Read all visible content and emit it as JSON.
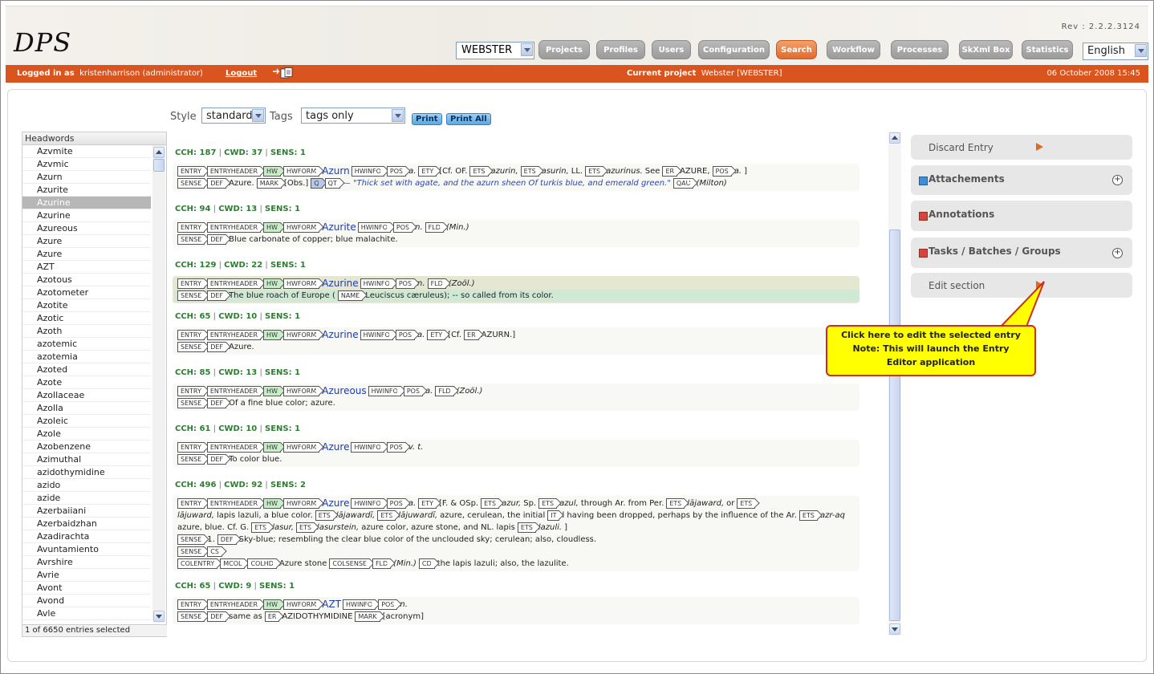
{
  "header": {
    "logo": "DPS",
    "revision": "Rev : 2.2.2.3124",
    "project_select": "WEBSTER",
    "nav": [
      "Projects",
      "Profiles",
      "Users",
      "Configuration",
      "Search",
      "Workflow",
      "Processes",
      "SkXml Box",
      "Statistics"
    ],
    "active_nav": "Search",
    "language": "English",
    "accent_color": "#d9541e"
  },
  "statusbar": {
    "logged_label": "Logged in as",
    "user": "kristenharrison (administrator)",
    "logout": "Logout",
    "current_project_label": "Current project",
    "current_project": "Webster [WEBSTER]",
    "date": "06 October 2008 15:45"
  },
  "toolbar": {
    "style_label": "Style",
    "style_value": "standard",
    "tags_label": "Tags",
    "tags_value": "tags only",
    "print": "Print",
    "print_all": "Print All"
  },
  "headwords": {
    "title": "Headwords",
    "items": [
      "Azvmite",
      "Azvmic",
      "Azurn",
      "Azurite",
      "Azurine",
      "Azurine",
      "Azureous",
      "Azure",
      "Azure",
      "AZT",
      "Azotous",
      "Azotometer",
      "Azotite",
      "Azotic",
      "Azoth",
      "azotemic",
      "azotemia",
      "Azoted",
      "Azote",
      "Azollaceae",
      "Azolla",
      "Azoleic",
      "Azole",
      "Azobenzene",
      "Azimuthal",
      "azidothymidine",
      "azido",
      "azide",
      "Azerbaiiani",
      "Azerbaidzhan",
      "Azadirachta",
      "Avuntamiento",
      "Avrshire",
      "Avrie",
      "Avont",
      "Avond",
      "Avle"
    ],
    "selected_index": 4,
    "status": "1 of 6650 entries selected"
  },
  "entries": [
    {
      "stats": {
        "cch": "CCH: 187",
        "cwd": "CWD: 37",
        "sens": "SENS: 1"
      },
      "rows": [
        [
          [
            "tag",
            "ENTRY"
          ],
          [
            "tag",
            "ENTRYHEADER"
          ],
          [
            "taghw",
            "HW"
          ],
          [
            "tag",
            "HWFORM"
          ],
          [
            "word",
            "Azurn"
          ],
          [
            "tag",
            "HWINFO"
          ],
          [
            "tag",
            "POS"
          ],
          [
            "it",
            "a."
          ],
          [
            "tag",
            "ETY"
          ],
          [
            "txt",
            "[Cf. OF."
          ],
          [
            "tag",
            "ETS"
          ],
          [
            "it",
            "azurin,"
          ],
          [
            "tag",
            "ETS"
          ],
          [
            "it",
            "asurin,"
          ],
          [
            "txt",
            "LL."
          ],
          [
            "tag",
            "ETS"
          ],
          [
            "it",
            "azurinus."
          ],
          [
            "txt",
            "See"
          ],
          [
            "tag",
            "ER"
          ],
          [
            "txt",
            "AZURE,"
          ],
          [
            "tag",
            "POS"
          ],
          [
            "it",
            "a."
          ],
          [
            "txt",
            "]"
          ]
        ],
        [
          [
            "tag",
            "SENSE"
          ],
          [
            "tag",
            "DEF"
          ],
          [
            "txt",
            "Azure."
          ],
          [
            "tag",
            "MARK"
          ],
          [
            "txt",
            "[Obs.]"
          ],
          [
            "tagq",
            "Q"
          ],
          [
            "tag",
            "QT"
          ],
          [
            "quote",
            "— \"Thick set with agate, and the azurn sheen Of turkis blue, and emerald green.\""
          ],
          [
            "tag",
            "QAU"
          ],
          [
            "it",
            "(Milton)"
          ]
        ]
      ]
    },
    {
      "stats": {
        "cch": "CCH: 94",
        "cwd": "CWD: 13",
        "sens": "SENS: 1"
      },
      "rows": [
        [
          [
            "tag",
            "ENTRY"
          ],
          [
            "tag",
            "ENTRYHEADER"
          ],
          [
            "taghw",
            "HW"
          ],
          [
            "tag",
            "HWFORM"
          ],
          [
            "word",
            "Azurite"
          ],
          [
            "tag",
            "HWINFO"
          ],
          [
            "tag",
            "POS"
          ],
          [
            "it",
            "n."
          ],
          [
            "tag",
            "FLD"
          ],
          [
            "it",
            "(Min.)"
          ]
        ],
        [
          [
            "tag",
            "SENSE"
          ],
          [
            "tag",
            "DEF"
          ],
          [
            "txt",
            "Blue carbonate of copper; blue malachite."
          ]
        ]
      ]
    },
    {
      "stats": {
        "cch": "CCH: 129",
        "cwd": "CWD: 22",
        "sens": "SENS: 1"
      },
      "selected": true,
      "rows": [
        [
          [
            "tag",
            "ENTRY"
          ],
          [
            "tag",
            "ENTRYHEADER"
          ],
          [
            "taghw",
            "HW"
          ],
          [
            "tag",
            "HWFORM"
          ],
          [
            "word",
            "Azurine"
          ],
          [
            "tag",
            "HWINFO"
          ],
          [
            "tag",
            "POS"
          ],
          [
            "it",
            "n."
          ],
          [
            "tag",
            "FLD"
          ],
          [
            "it",
            "(Zoöl.)"
          ]
        ],
        [
          [
            "tag",
            "SENSE"
          ],
          [
            "tag",
            "DEF"
          ],
          [
            "txt",
            "The blue roach of Europe ("
          ],
          [
            "tag",
            "NAME"
          ],
          [
            "txt",
            "Leuciscus cæruleus); -- so called from its color."
          ]
        ]
      ]
    },
    {
      "stats": {
        "cch": "CCH: 65",
        "cwd": "CWD: 10",
        "sens": "SENS: 1"
      },
      "rows": [
        [
          [
            "tag",
            "ENTRY"
          ],
          [
            "tag",
            "ENTRYHEADER"
          ],
          [
            "taghw",
            "HW"
          ],
          [
            "tag",
            "HWFORM"
          ],
          [
            "word",
            "Azurine"
          ],
          [
            "tag",
            "HWINFO"
          ],
          [
            "tag",
            "POS"
          ],
          [
            "it",
            "a."
          ],
          [
            "tag",
            "ETY"
          ],
          [
            "txt",
            "[Cf."
          ],
          [
            "tag",
            "ER"
          ],
          [
            "txt",
            "AZURN.]"
          ]
        ],
        [
          [
            "tag",
            "SENSE"
          ],
          [
            "tag",
            "DEF"
          ],
          [
            "txt",
            "Azure."
          ]
        ]
      ]
    },
    {
      "stats": {
        "cch": "CCH: 85",
        "cwd": "CWD: 13",
        "sens": "SENS: 1"
      },
      "rows": [
        [
          [
            "tag",
            "ENTRY"
          ],
          [
            "tag",
            "ENTRYHEADER"
          ],
          [
            "taghw",
            "HW"
          ],
          [
            "tag",
            "HWFORM"
          ],
          [
            "word",
            "Azureous"
          ],
          [
            "tag",
            "HWINFO"
          ],
          [
            "tag",
            "POS"
          ],
          [
            "it",
            "a."
          ],
          [
            "tag",
            "FLD"
          ],
          [
            "it",
            "(Zoöl.)"
          ]
        ],
        [
          [
            "tag",
            "SENSE"
          ],
          [
            "tag",
            "DEF"
          ],
          [
            "txt",
            "Of a fine blue color; azure."
          ]
        ]
      ]
    },
    {
      "stats": {
        "cch": "CCH: 61",
        "cwd": "CWD: 10",
        "sens": "SENS: 1"
      },
      "rows": [
        [
          [
            "tag",
            "ENTRY"
          ],
          [
            "tag",
            "ENTRYHEADER"
          ],
          [
            "taghw",
            "HW"
          ],
          [
            "tag",
            "HWFORM"
          ],
          [
            "word",
            "Azure"
          ],
          [
            "tag",
            "HWINFO"
          ],
          [
            "tag",
            "POS"
          ],
          [
            "it",
            "v. t."
          ]
        ],
        [
          [
            "tag",
            "SENSE"
          ],
          [
            "tag",
            "DEF"
          ],
          [
            "txt",
            "To color blue."
          ]
        ]
      ]
    },
    {
      "stats": {
        "cch": "CCH: 496",
        "cwd": "CWD: 92",
        "sens": "SENS: 2"
      },
      "rows": [
        [
          [
            "tag",
            "ENTRY"
          ],
          [
            "tag",
            "ENTRYHEADER"
          ],
          [
            "taghw",
            "HW"
          ],
          [
            "tag",
            "HWFORM"
          ],
          [
            "word",
            "Azure"
          ],
          [
            "tag",
            "HWINFO"
          ],
          [
            "tag",
            "POS"
          ],
          [
            "it",
            "a."
          ],
          [
            "tag",
            "ETY"
          ],
          [
            "txt",
            "[F. & OSp."
          ],
          [
            "tag",
            "ETS"
          ],
          [
            "it",
            "azur,"
          ],
          [
            "txt",
            "Sp."
          ],
          [
            "tag",
            "ETS"
          ],
          [
            "it",
            "azul,"
          ],
          [
            "txt",
            "through Ar. from Per."
          ],
          [
            "tag",
            "ETS"
          ],
          [
            "it",
            "lājaward,"
          ],
          [
            "txt",
            "or"
          ],
          [
            "tag",
            "ETS"
          ]
        ],
        [
          [
            "it",
            "lājuward,"
          ],
          [
            "txt",
            "lapis lazuli, a blue color."
          ],
          [
            "tag",
            "ETS"
          ],
          [
            "it",
            "lājawardī,"
          ],
          [
            "tag",
            "ETS"
          ],
          [
            "it",
            "lājuwardī,"
          ],
          [
            "txt",
            "azure, cerulean, the initial"
          ],
          [
            "tag",
            "IT"
          ],
          [
            "txt",
            "l having been dropped, perhaps by the influence of the Ar."
          ],
          [
            "tag",
            "ETS"
          ],
          [
            "it",
            "azr-aq"
          ]
        ],
        [
          [
            "txt",
            "azure, blue. Cf. G."
          ],
          [
            "tag",
            "ETS"
          ],
          [
            "it",
            "lasur,"
          ],
          [
            "tag",
            "ETS"
          ],
          [
            "it",
            "lasurstein,"
          ],
          [
            "txt",
            "azure color, azure stone, and NL. lapis"
          ],
          [
            "tag",
            "ETS"
          ],
          [
            "it",
            "lazuli."
          ],
          [
            "txt",
            "]"
          ]
        ],
        [
          [
            "tag",
            "SENSE"
          ],
          [
            "txt",
            "1."
          ],
          [
            "tag",
            "DEF"
          ],
          [
            "txt",
            "Sky-blue; resembling the clear blue color of the unclouded sky; cerulean; also, cloudless."
          ]
        ],
        [
          [
            "tag",
            "SENSE"
          ],
          [
            "tag",
            "CS"
          ]
        ],
        [
          [
            "tag",
            "COLENTRY"
          ],
          [
            "tag",
            "MCOL"
          ],
          [
            "tag",
            "COLHD"
          ],
          [
            "txt",
            "Azure stone"
          ],
          [
            "tag",
            "COLSENSE"
          ],
          [
            "tag",
            "FLD"
          ],
          [
            "it",
            "(Min.)"
          ],
          [
            "tag",
            "CD"
          ],
          [
            "txt",
            "the lapis lazuli; also, the lazulite."
          ]
        ]
      ]
    },
    {
      "stats": {
        "cch": "CCH: 65",
        "cwd": "CWD: 9",
        "sens": "SENS: 1"
      },
      "rows": [
        [
          [
            "tag",
            "ENTRY"
          ],
          [
            "tag",
            "ENTRYHEADER"
          ],
          [
            "taghw",
            "HW"
          ],
          [
            "tag",
            "HWFORM"
          ],
          [
            "word",
            "AZT"
          ],
          [
            "tag",
            "HWINFO"
          ],
          [
            "tag",
            "POS"
          ],
          [
            "it",
            "n."
          ]
        ],
        [
          [
            "tag",
            "SENSE"
          ],
          [
            "tag",
            "DEF"
          ],
          [
            "txt",
            "same as"
          ],
          [
            "tag",
            "ER"
          ],
          [
            "txt",
            "AZIDOTHYMIDINE"
          ],
          [
            "tag",
            "MARK"
          ],
          [
            "txt",
            "[acronym]"
          ]
        ]
      ]
    }
  ],
  "right_panel": {
    "discard": "Discard Entry",
    "attachments": "Attachements",
    "annotations": "Annotations",
    "tasks": "Tasks / Batches / Groups",
    "edit": "Edit section"
  },
  "callout": {
    "line1": "Click here to edit the selected entry",
    "line2": "Note: This will launch the Entry",
    "line3": "Editor application"
  }
}
